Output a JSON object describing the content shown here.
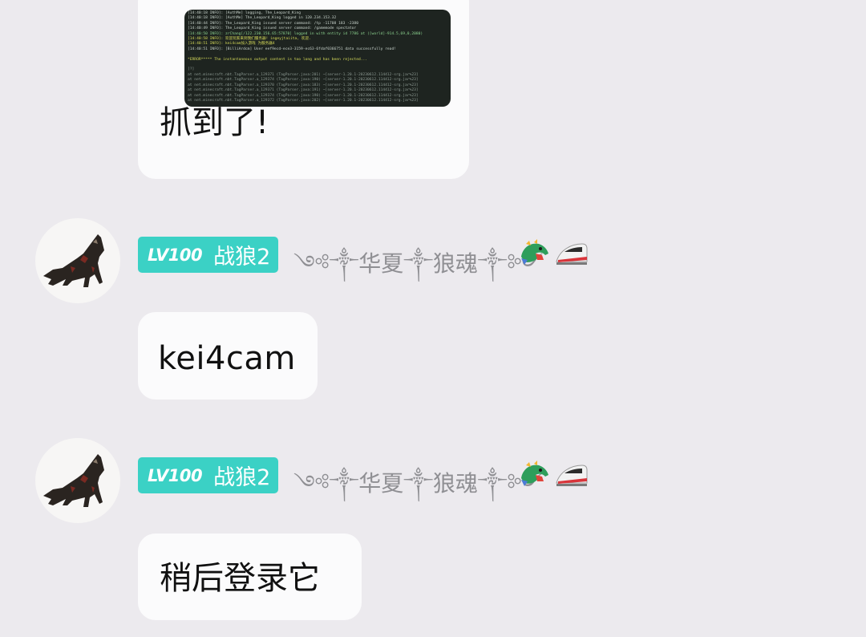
{
  "messages": [
    {
      "type": "image_with_text",
      "console_lines": [
        "[14:40:18 INFO]: [AuthMe] logging, The_Leopard_King",
        "[14:40:18 INFO]: [AuthMe] The_Leopard_King logged in 120.234.153.32",
        "[14:40:44 INFO]: The_Leopard_King issued server command: /tp -11708 183 -2380",
        "[14:40:49 INFO]: The_Leopard_King issued server command: /gamemode spectator",
        "[14:40:50 INFO]: zrChang[/122.230.156.65:57870] logged in with entity id 7786 at ([world]-914.5,69,0,2080)",
        "[14:40:58 INFO]: 欢迎玩家来到我们服务器! ingeyjtaiita, 欢迎.",
        "[14:40:51 INFO]: kei4cam加入游戏 为服务器4",
        "[14:40:51 INFO]: [BilliArdcm] User eef9ecd-ece3-3159-ec63-6fdaf0366751 data successfully read!",
        "",
        "*ERROR***** The instantaneous output content is too long and has been rejected...",
        "",
        "[?]",
        "    at net.minecraft.nbt.TagParser.a_129371 (TagParser.java:201) ~[server-1.20.1-20230612.114412-srg.jar%23]",
        "    at net.minecraft.nbt.TagParser.a_129374 (TagParser.java:190) ~[server-1.20.1-20230612.114412-srg.jar%23]",
        "    at net.minecraft.nbt.TagParser.a_129370 (TagParser.java:183) ~[server-1.20.1-20230612.114412-srg.jar%23]",
        "    at net.minecraft.nbt.TagParser.a_129371 (TagParser.java:191) ~[server-1.20.1-20230612.114412-srg.jar%23]",
        "    at net.minecraft.nbt.TagParser.a_129374 (TagParser.java:190) ~[server-1.20.1-20230612.114412-srg.jar%23]",
        "    at net.minecraft.nbt.TagParser.a_129372 (TagParser.java:202) ~[server-1.20.1-20230612.114412-srg.jar%23]"
      ],
      "text": "抓到了!"
    },
    {
      "type": "text",
      "sender": {
        "level": "LV100",
        "name": "战狼2",
        "title": "༺༒华夏༒狼魂༒༻",
        "emojis": [
          "dragon-emoji",
          "bullet-train-emoji"
        ]
      },
      "text": "kei4cam"
    },
    {
      "type": "text",
      "sender": {
        "level": "LV100",
        "name": "战狼2",
        "title": "༺༒华夏༒狼魂༒༻",
        "emojis": [
          "dragon-emoji",
          "bullet-train-emoji"
        ]
      },
      "text": "稍后登录它"
    }
  ],
  "colors": {
    "background": "#eceaee",
    "bubble": "#fbfbfc",
    "badge": "#3bd1c5",
    "title_text": "#8f8f93"
  }
}
